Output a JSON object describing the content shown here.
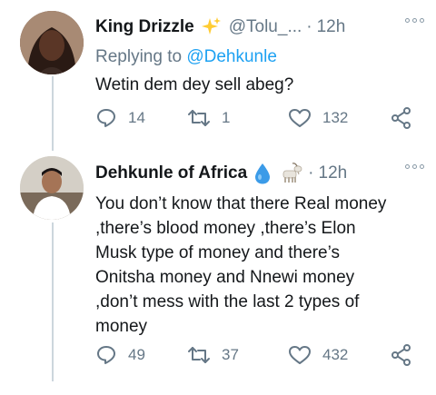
{
  "tweets": [
    {
      "name": "King Drizzle",
      "emoji": "sparkles-icon",
      "handle": "@Tolu_...",
      "dot": "·",
      "time": "12h",
      "replying_prefix": "Replying to",
      "replying_to": "@Dehkunle",
      "text": "Wetin dem dey sell abeg?",
      "replies": "14",
      "retweets": "1",
      "likes": "132"
    },
    {
      "name": "Dehkunle of Africa",
      "emoji": [
        "droplet-icon",
        "goat-icon"
      ],
      "dot": "·",
      "time": "12h",
      "text_lines": [
        "You don’t know that there Real money",
        ",there’s blood money ,there’s Elon",
        "Musk type of money and there’s",
        "Onitsha money and Nnewi money",
        ",don’t mess with the last 2 types of",
        "money"
      ],
      "replies": "49",
      "retweets": "37",
      "likes": "432"
    }
  ],
  "colors": {
    "text": "#14171a",
    "secondary": "#657786",
    "link": "#1da1f2",
    "thread_line": "#ccd6dd"
  }
}
